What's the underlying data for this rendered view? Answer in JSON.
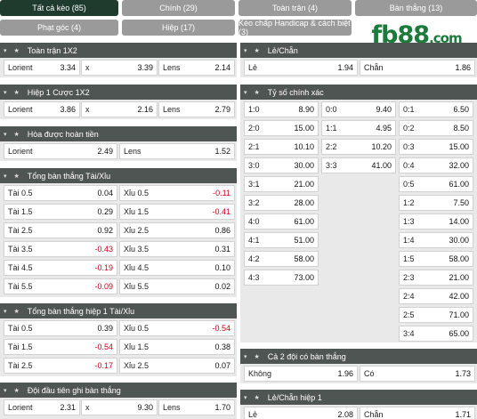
{
  "tabs": [
    {
      "label": "Tất cả kèo (85)",
      "active": true
    },
    {
      "label": "Chính (29)",
      "active": false
    },
    {
      "label": "Toàn trận (4)",
      "active": false
    },
    {
      "label": "Bàn thắng (13)",
      "active": false
    },
    {
      "label": "Phạt góc (4)",
      "active": false
    },
    {
      "label": "Hiệp (17)",
      "active": false
    },
    {
      "label": "Kèo chấp Handicap & cách biệt (3)",
      "active": false
    }
  ],
  "logo": {
    "main": "fb88",
    "suffix": ".com"
  },
  "header_icons": "▾ ★",
  "sections": {
    "toan_tran_1x2": {
      "title": "Toàn trận 1X2",
      "cells": [
        {
          "label": "Lorient",
          "value": "3.34"
        },
        {
          "label": "x",
          "value": "3.39"
        },
        {
          "label": "Lens",
          "value": "2.14"
        }
      ]
    },
    "hiep1_cuoc_1x2": {
      "title": "Hiệp 1 Cược 1X2",
      "cells": [
        {
          "label": "Lorient",
          "value": "3.86"
        },
        {
          "label": "x",
          "value": "2.16"
        },
        {
          "label": "Lens",
          "value": "2.79"
        }
      ]
    },
    "hoa_duoc_hoan_tien": {
      "title": "Hòa được hoàn tiền",
      "cells": [
        {
          "label": "Lorient",
          "value": "2.49"
        },
        {
          "label": "Lens",
          "value": "1.52"
        }
      ]
    },
    "tong_ban_thang": {
      "title": "Tổng bàn thắng Tài/Xỉu",
      "rows": [
        [
          {
            "label": "Tài 0.5",
            "value": "0.04"
          },
          {
            "label": "Xỉu 0.5",
            "value": "-0.11"
          }
        ],
        [
          {
            "label": "Tài 1.5",
            "value": "0.29"
          },
          {
            "label": "Xỉu 1.5",
            "value": "-0.41"
          }
        ],
        [
          {
            "label": "Tài 2.5",
            "value": "0.92"
          },
          {
            "label": "Xỉu 2.5",
            "value": "0.86"
          }
        ],
        [
          {
            "label": "Tài 3.5",
            "value": "-0.43"
          },
          {
            "label": "Xỉu 3.5",
            "value": "0.31"
          }
        ],
        [
          {
            "label": "Tài 4.5",
            "value": "-0.19"
          },
          {
            "label": "Xỉu 4.5",
            "value": "0.10"
          }
        ],
        [
          {
            "label": "Tài 5.5",
            "value": "-0.09"
          },
          {
            "label": "Xỉu 5.5",
            "value": "0.02"
          }
        ]
      ]
    },
    "tong_ban_thang_hiep1": {
      "title": "Tổng bàn thắng hiệp 1 Tài/Xỉu",
      "rows": [
        [
          {
            "label": "Tài 0.5",
            "value": "0.39"
          },
          {
            "label": "Xỉu 0.5",
            "value": "-0.54"
          }
        ],
        [
          {
            "label": "Tài 1.5",
            "value": "-0.54"
          },
          {
            "label": "Xỉu 1.5",
            "value": "0.38"
          }
        ],
        [
          {
            "label": "Tài 2.5",
            "value": "-0.17"
          },
          {
            "label": "Xỉu 2.5",
            "value": "0.07"
          }
        ]
      ]
    },
    "doi_dau_tien": {
      "title": "Đội đầu tiên ghi bàn thắng",
      "cells": [
        {
          "label": "Lorient",
          "value": "2.31"
        },
        {
          "label": "x",
          "value": "9.30"
        },
        {
          "label": "Lens",
          "value": "1.70"
        }
      ]
    },
    "le_chan": {
      "title": "Lẻ/Chẵn",
      "cells": [
        {
          "label": "Lẻ",
          "value": "1.94"
        },
        {
          "label": "Chẵn",
          "value": "1.86"
        }
      ]
    },
    "ty_so_chinh_xac": {
      "title": "Tỷ số chính xác",
      "col1": [
        {
          "label": "1:0",
          "value": "8.90"
        },
        {
          "label": "2:0",
          "value": "15.00"
        },
        {
          "label": "2:1",
          "value": "10.10"
        },
        {
          "label": "3:0",
          "value": "30.00"
        },
        {
          "label": "3:1",
          "value": "21.00"
        },
        {
          "label": "3:2",
          "value": "28.00"
        },
        {
          "label": "4:0",
          "value": "61.00"
        },
        {
          "label": "4:1",
          "value": "51.00"
        },
        {
          "label": "4:2",
          "value": "58.00"
        },
        {
          "label": "4:3",
          "value": "73.00"
        }
      ],
      "col2": [
        {
          "label": "0:0",
          "value": "9.40"
        },
        {
          "label": "1:1",
          "value": "4.95"
        },
        {
          "label": "2:2",
          "value": "10.20"
        },
        {
          "label": "3:3",
          "value": "41.00"
        }
      ],
      "col3": [
        {
          "label": "0:1",
          "value": "6.50"
        },
        {
          "label": "0:2",
          "value": "8.50"
        },
        {
          "label": "0:3",
          "value": "15.00"
        },
        {
          "label": "0:4",
          "value": "32.00"
        },
        {
          "label": "0:5",
          "value": "61.00"
        },
        {
          "label": "1:2",
          "value": "7.50"
        },
        {
          "label": "1:3",
          "value": "14.00"
        },
        {
          "label": "1:4",
          "value": "30.00"
        },
        {
          "label": "1:5",
          "value": "58.00"
        },
        {
          "label": "2:3",
          "value": "21.00"
        },
        {
          "label": "2:4",
          "value": "42.00"
        },
        {
          "label": "2:5",
          "value": "71.00"
        },
        {
          "label": "3:4",
          "value": "65.00"
        }
      ]
    },
    "ca_2_doi": {
      "title": "Cả 2 đội có bàn thắng",
      "cells": [
        {
          "label": "Không",
          "value": "1.96"
        },
        {
          "label": "Có",
          "value": "1.73"
        }
      ]
    },
    "le_chan_hiep1": {
      "title": "Lẻ/Chẵn hiệp 1",
      "cells": [
        {
          "label": "Lẻ",
          "value": "2.08"
        },
        {
          "label": "Chẵn",
          "value": "1.71"
        }
      ]
    }
  },
  "colors": {
    "header_bg": "#4f5552",
    "tab_active": "#1f3b2e",
    "tab_inactive": "#9a9a9a",
    "negative": "#d0021b",
    "logo": "#1c7a3a"
  }
}
